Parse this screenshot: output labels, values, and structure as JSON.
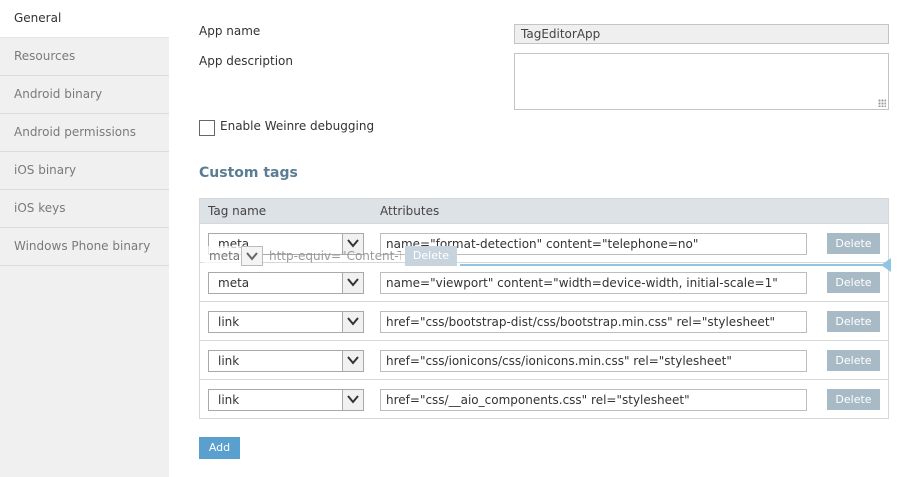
{
  "sidebar": {
    "items": [
      {
        "label": "General"
      },
      {
        "label": "Resources"
      },
      {
        "label": "Android binary"
      },
      {
        "label": "Android permissions"
      },
      {
        "label": "iOS binary"
      },
      {
        "label": "iOS keys"
      },
      {
        "label": "Windows Phone binary"
      }
    ]
  },
  "form": {
    "app_name_label": "App name",
    "app_name_value": "TagEditorApp",
    "app_desc_label": "App description",
    "app_desc_value": "",
    "weinre_label": "Enable Weinre debugging",
    "weinre_checked": false
  },
  "custom_tags": {
    "title": "Custom tags",
    "headers": {
      "tag": "Tag name",
      "attrs": "Attributes"
    },
    "delete_label": "Delete",
    "rows": [
      {
        "tag": "meta",
        "attrs": "name=\"format-detection\" content=\"telephone=no\""
      },
      {
        "tag": "meta",
        "attrs": "name=\"viewport\" content=\"width=device-width, initial-scale=1\""
      },
      {
        "tag": "link",
        "attrs": "href=\"css/bootstrap-dist/css/bootstrap.min.css\" rel=\"stylesheet\""
      },
      {
        "tag": "link",
        "attrs": "href=\"css/ionicons/css/ionicons.min.css\" rel=\"stylesheet\""
      },
      {
        "tag": "link",
        "attrs": "href=\"css/__aio_components.css\" rel=\"stylesheet\""
      }
    ],
    "dragging_row": {
      "tag": "meta",
      "attrs": "http-equiv=\"Content-Ty",
      "delete_label": "Delete"
    },
    "add_label": "Add"
  },
  "colors": {
    "accent": "#5aa0cf",
    "section_title": "#5a7d94",
    "delete_button": "#a9bac7",
    "drop_indicator": "#8fc4e3"
  }
}
